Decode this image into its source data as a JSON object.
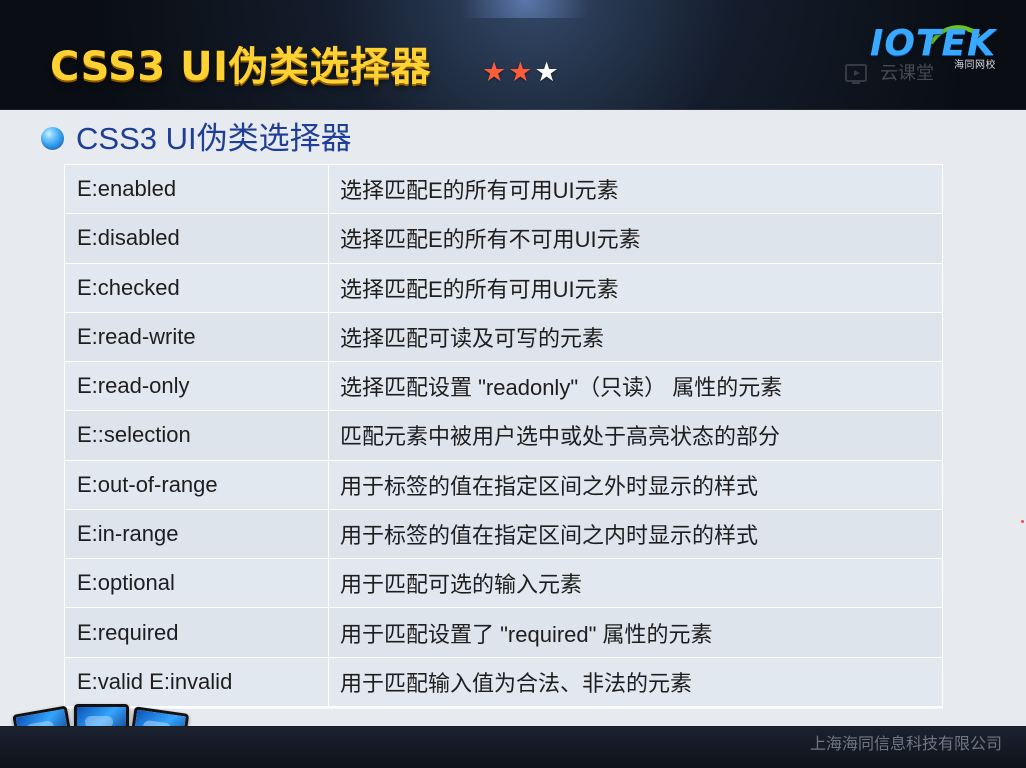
{
  "header": {
    "title": "CSS3 UI伪类选择器",
    "stars": [
      "red",
      "red",
      "white"
    ],
    "logo": {
      "main": "IOTEK",
      "sub": "海同网校"
    },
    "watermark": "云课堂"
  },
  "section": {
    "title": "CSS3 UI伪类选择器"
  },
  "rows": [
    {
      "selector": "E:enabled",
      "description": "选择匹配E的所有可用UI元素"
    },
    {
      "selector": "E:disabled",
      "description": "选择匹配E的所有不可用UI元素"
    },
    {
      "selector": "E:checked",
      "description": "选择匹配E的所有可用UI元素"
    },
    {
      "selector": "E:read-write",
      "description": "选择匹配可读及可写的元素"
    },
    {
      "selector": "E:read-only",
      "description": "选择匹配设置 \"readonly\"（只读） 属性的元素"
    },
    {
      "selector": "E::selection",
      "description": "匹配元素中被用户选中或处于高亮状态的部分"
    },
    {
      "selector": "E:out-of-range",
      "description": "用于标签的值在指定区间之外时显示的样式"
    },
    {
      "selector": "E:in-range",
      "description": "用于标签的值在指定区间之内时显示的样式"
    },
    {
      "selector": "E:optional",
      "description": "用于匹配可选的输入元素"
    },
    {
      "selector": "E:required",
      "description": "用于匹配设置了 \"required\" 属性的元素"
    },
    {
      "selector": "E:valid E:invalid",
      "description": "用于匹配输入值为合法、非法的元素"
    }
  ],
  "footer": {
    "company": "上海海同信息科技有限公司"
  },
  "colors": {
    "title_yellow": "#ffd233",
    "section_blue": "#1f3f95",
    "logo_blue": "#38a9ff",
    "header_dark": "#0f131a"
  }
}
